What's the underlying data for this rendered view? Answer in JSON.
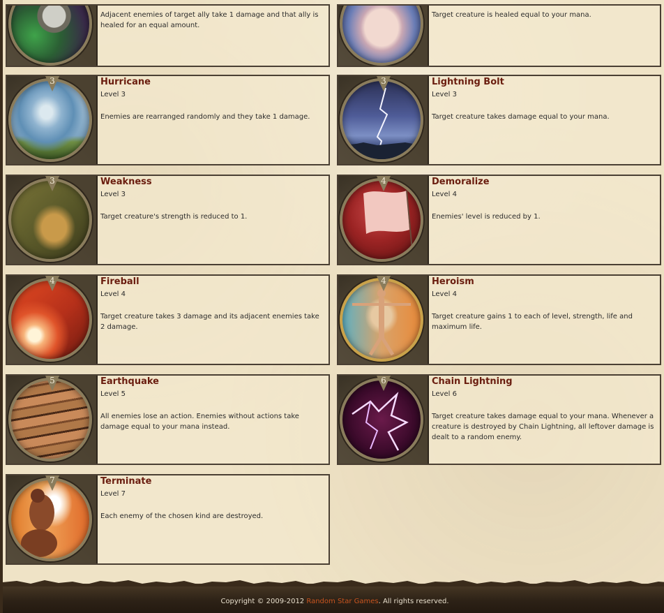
{
  "spells": [
    {
      "name": "",
      "level_text": "",
      "badge": "",
      "description": "Adjacent enemies of target ally take 1 damage and that ally is healed for an equal amount.",
      "icon": "skull-icon"
    },
    {
      "name": "",
      "level_text": "",
      "badge": "",
      "description": "Target creature is healed equal to your mana.",
      "icon": "healing-face-icon"
    },
    {
      "name": "Hurricane",
      "level_text": "Level 3",
      "badge": "3",
      "description": "Enemies are rearranged randomly and they take 1 damage.",
      "icon": "hurricane-icon"
    },
    {
      "name": "Lightning Bolt",
      "level_text": "Level 3",
      "badge": "3",
      "description": "Target creature takes damage equal to your mana.",
      "icon": "lightning-bolt-icon"
    },
    {
      "name": "Weakness",
      "level_text": "Level 3",
      "badge": "3",
      "description": "Target creature's strength is reduced to 1.",
      "icon": "weak-arm-icon"
    },
    {
      "name": "Demoralize",
      "level_text": "Level 4",
      "badge": "4",
      "description": "Enemies' level is reduced by 1.",
      "icon": "white-flag-icon"
    },
    {
      "name": "Fireball",
      "level_text": "Level 4",
      "badge": "4",
      "description": "Target creature takes 3 damage and its adjacent enemies take 2 damage.",
      "icon": "fireball-icon"
    },
    {
      "name": "Heroism",
      "level_text": "Level 4",
      "badge": "4",
      "description": "Target creature gains 1 to each of level, strength, life and maximum life.",
      "icon": "hero-figure-icon"
    },
    {
      "name": "Earthquake",
      "level_text": "Level 5",
      "badge": "5",
      "description": "All enemies lose an action. Enemies without actions take damage equal to your mana instead.",
      "icon": "earthquake-icon"
    },
    {
      "name": "Chain Lightning",
      "level_text": "Level 6",
      "badge": "6",
      "description": "Target creature takes damage equal to your mana. Whenever a creature is destroyed by Chain Lightning, all leftover damage is dealt to a random enemy.",
      "icon": "chain-lightning-icon"
    },
    {
      "name": "Terminate",
      "level_text": "Level 7",
      "badge": "7",
      "description": "Each enemy of the chosen kind are destroyed.",
      "icon": "terminate-icon"
    }
  ],
  "footer": {
    "copyright": "Copyright © 2009-2012",
    "company": "Random Star Games",
    "rights": ". All rights reserved."
  }
}
